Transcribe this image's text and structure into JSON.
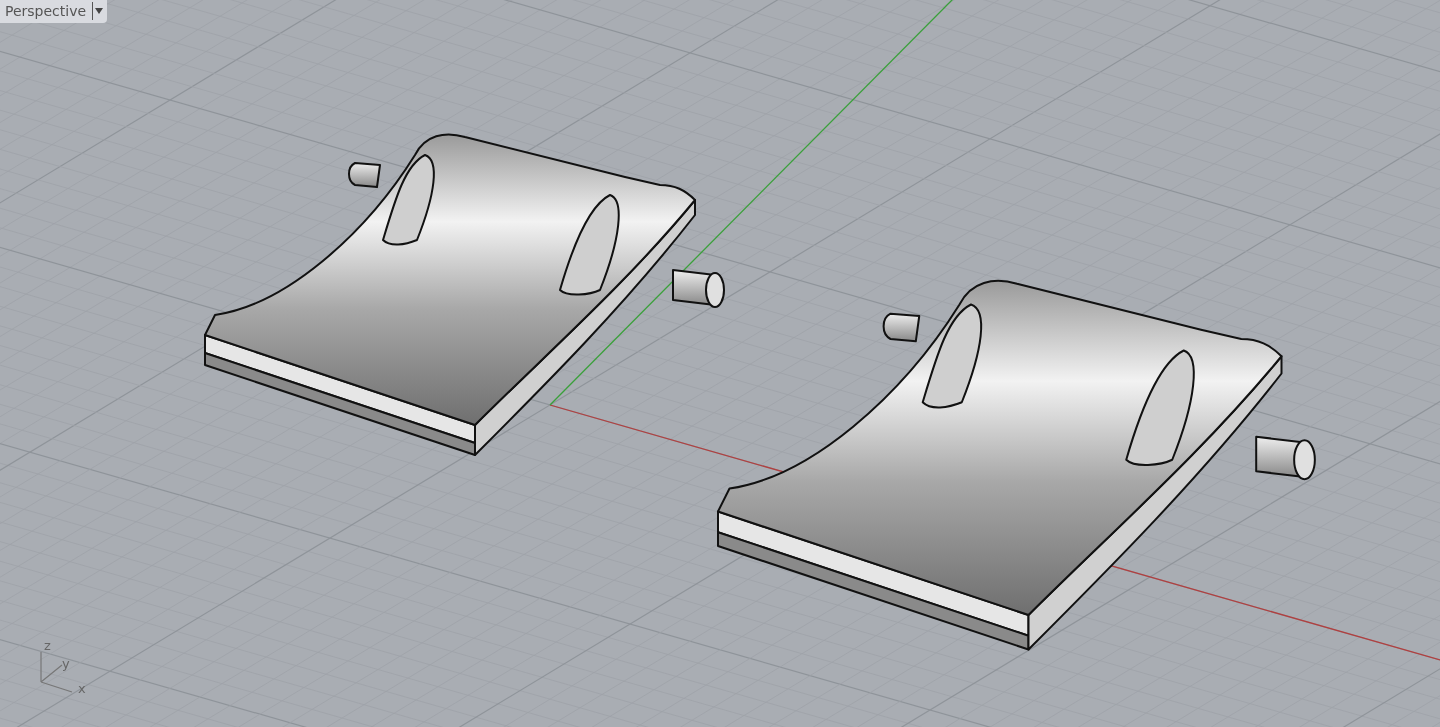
{
  "viewport": {
    "title": "Perspective"
  },
  "axis_indicator": {
    "labels": [
      "z",
      "y",
      "x"
    ]
  }
}
